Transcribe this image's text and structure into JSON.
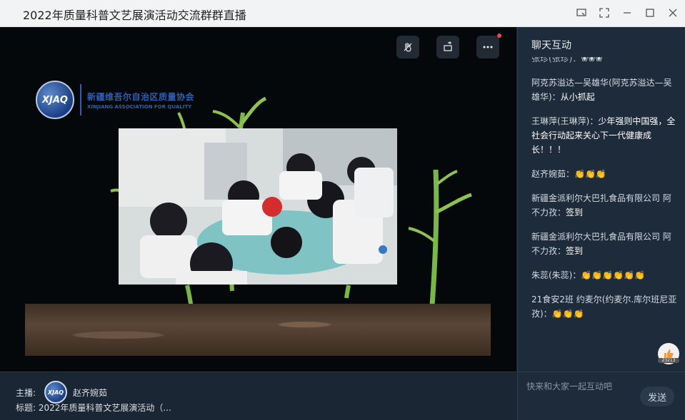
{
  "window": {
    "title": "2022年质量科普文艺展演活动交流群群直播"
  },
  "logo": {
    "badge_text": "XJAQ",
    "name_cn": "新疆维吾尔自治区质量协会",
    "name_en": "XINJIANG ASSOCIATION FOR QUALITY"
  },
  "chat": {
    "header": "聊天互动",
    "messages": [
      {
        "sender": "张珍(张珍)：",
        "text": "❀❀❀"
      },
      {
        "sender": "阿克苏溢达—吴雄华(阿克苏溢达—吴雄华)：",
        "text": "从小抓起"
      },
      {
        "sender": "王琳萍(王琳萍)：",
        "text": "少年强则中国强，全社会行动起来关心下一代健康成长！！！"
      },
      {
        "sender": "赵齐婉茹：",
        "text": "👏👏👏"
      },
      {
        "sender": "新疆金派利尔大巴扎食品有限公司 阿不力孜：",
        "text": "签到"
      },
      {
        "sender": "新疆金派利尔大巴扎食品有限公司 阿不力孜：",
        "text": "签到"
      },
      {
        "sender": "朱蕊(朱蕊)：",
        "text": "👏👏👏👏👏👏"
      },
      {
        "sender": "21食安2班 约麦尔(约麦尔.库尔班尼亚孜)：",
        "text": "👏👏👏"
      }
    ],
    "like_count": "23213",
    "input_placeholder": "快来和大家一起互动吧",
    "send_label": "发送"
  },
  "footer": {
    "host_label": "主播:",
    "host_avatar_text": "XJAQ",
    "host_name": "赵齐婉茹",
    "topic_label": "标题:",
    "topic": "2022年质量科普文艺展演活动（..."
  },
  "colors": {
    "chat_bg": "#1e2b3a",
    "video_bg": "#05080b",
    "accent_red": "#e5484d"
  }
}
